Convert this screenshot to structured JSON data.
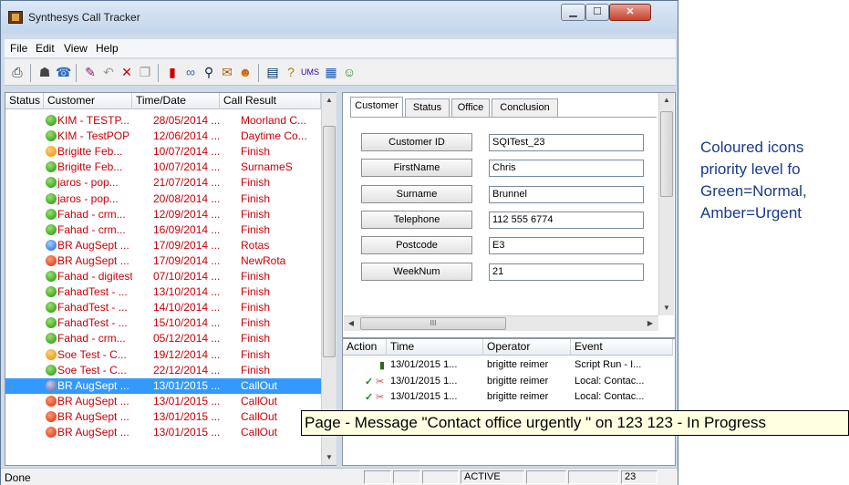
{
  "window": {
    "title": "Synthesys Call Tracker"
  },
  "menu": [
    "File",
    "Edit",
    "View",
    "Help"
  ],
  "toolbar_icons": [
    "print-icon",
    "search-person-icon",
    "phone-book-icon",
    "edit-icon",
    "undo-icon",
    "delete-icon",
    "copy-icon",
    "traffic-light-icon",
    "link-icon",
    "magnify-icon",
    "notes-icon",
    "user-search-icon",
    "book-icon",
    "help-icon",
    "ums-icon",
    "calendar-icon",
    "people-icon"
  ],
  "toolbar_ums_label": "UMS",
  "call_list": {
    "columns": [
      "Status",
      "Customer",
      "Time/Date",
      "Call Result"
    ],
    "rows": [
      {
        "status": "green",
        "customer": "KIM - TESTP...",
        "time": "28/05/2014 ...",
        "result": "Moorland C..."
      },
      {
        "status": "green",
        "customer": "KIM - TestPOP",
        "time": "12/06/2014 ...",
        "result": "Daytime Co..."
      },
      {
        "status": "amber",
        "customer": "Brigitte Feb...",
        "time": "10/07/2014 ...",
        "result": "Finish"
      },
      {
        "status": "green",
        "customer": "Brigitte Feb...",
        "time": "10/07/2014 ...",
        "result": "SurnameS"
      },
      {
        "status": "green",
        "customer": "jaros - pop...",
        "time": "21/07/2014 ...",
        "result": "Finish"
      },
      {
        "status": "green",
        "customer": "jaros - pop...",
        "time": "20/08/2014 ...",
        "result": "Finish"
      },
      {
        "status": "green",
        "customer": "Fahad - crm...",
        "time": "12/09/2014 ...",
        "result": "Finish"
      },
      {
        "status": "green",
        "customer": "Fahad - crm...",
        "time": "16/09/2014 ...",
        "result": "Finish"
      },
      {
        "status": "blue",
        "customer": "BR AugSept ...",
        "time": "17/09/2014 ...",
        "result": "Rotas"
      },
      {
        "status": "red",
        "customer": "BR AugSept ...",
        "time": "17/09/2014 ...",
        "result": "NewRota"
      },
      {
        "status": "green",
        "customer": "Fahad - digitest",
        "time": "07/10/2014 ...",
        "result": "Finish"
      },
      {
        "status": "green",
        "customer": "FahadTest - ...",
        "time": "13/10/2014 ...",
        "result": "Finish"
      },
      {
        "status": "green",
        "customer": "FahadTest - ...",
        "time": "14/10/2014 ...",
        "result": "Finish"
      },
      {
        "status": "green",
        "customer": "FahadTest - ...",
        "time": "15/10/2014 ...",
        "result": "Finish"
      },
      {
        "status": "green",
        "customer": "Fahad - crm...",
        "time": "05/12/2014 ...",
        "result": "Finish"
      },
      {
        "status": "amber",
        "customer": "Soe Test - C...",
        "time": "19/12/2014 ...",
        "result": "Finish"
      },
      {
        "status": "green",
        "customer": "Soe Test - C...",
        "time": "22/12/2014 ...",
        "result": "Finish"
      },
      {
        "status": "grey",
        "customer": "BR AugSept ...",
        "time": "13/01/2015 ...",
        "result": "CallOut"
      },
      {
        "status": "red",
        "customer": "BR AugSept ...",
        "time": "13/01/2015 ...",
        "result": "CallOut"
      },
      {
        "status": "red",
        "customer": "BR AugSept ...",
        "time": "13/01/2015 ...",
        "result": "CallOut"
      },
      {
        "status": "red",
        "customer": "BR AugSept ...",
        "time": "13/01/2015 ...",
        "result": "CallOut"
      }
    ],
    "selected_index": 17
  },
  "tabs": [
    "Customer",
    "Status",
    "Office",
    "Conclusion"
  ],
  "active_tab": "Customer",
  "customer_fields": [
    {
      "label": "Customer ID",
      "value": "SQITest_23"
    },
    {
      "label": "FirstName",
      "value": "Chris"
    },
    {
      "label": "Surname",
      "value": "Brunnel"
    },
    {
      "label": "Telephone",
      "value": "112 555 6774"
    },
    {
      "label": "Postcode",
      "value": "E3"
    },
    {
      "label": "WeekNum",
      "value": "21"
    }
  ],
  "hscroll_grip": "III",
  "event_log": {
    "columns": [
      "Action",
      "Time",
      "Operator",
      "Event"
    ],
    "rows": [
      {
        "action": "",
        "time": "13/01/2015 1...",
        "operator": "brigitte reimer",
        "event": "Script Run - I..."
      },
      {
        "action": "check",
        "time": "13/01/2015 1...",
        "operator": "brigitte reimer",
        "event": "Local: Contac..."
      },
      {
        "action": "check",
        "time": "13/01/2015 1...",
        "operator": "brigitte reimer",
        "event": "Local: Contac..."
      }
    ]
  },
  "status_bar": {
    "text": "Done",
    "state": "ACTIVE",
    "count": "23"
  },
  "tooltip": "Page - Message  \"Contact office urgently \" on 123 123 - In Progress",
  "annotation": [
    "Coloured icons",
    "priority level fo",
    "Green=Normal,",
    "Amber=Urgent"
  ]
}
